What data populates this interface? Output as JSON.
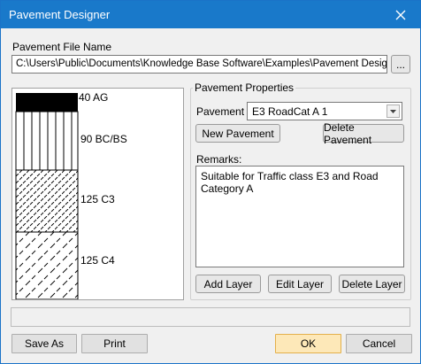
{
  "window": {
    "title": "Pavement Designer",
    "close_icon": "close-icon",
    "title_bar_color": "#1979ca"
  },
  "file": {
    "label": "Pavement File Name",
    "path": "C:\\Users\\Public\\Documents\\Knowledge Base Software\\Examples\\Pavement Designs\\TR",
    "browse_label": "..."
  },
  "layers": [
    {
      "label": "40 AG",
      "pattern": "solid-black"
    },
    {
      "label": "90 BC/BS",
      "pattern": "vertical-lines"
    },
    {
      "label": "125 C3",
      "pattern": "dashed-diagonal"
    },
    {
      "label": "125 C4",
      "pattern": "sparse-diagonal"
    }
  ],
  "properties": {
    "group_label": "Pavement Properties",
    "pavement_label": "Pavement",
    "pavement_value": "E3 RoadCat A 1",
    "new_label": "New Pavement",
    "delete_label": "Delete Pavement",
    "remarks_label": "Remarks:",
    "remarks_text": "Suitable for Traffic class E3 and Road Category A",
    "add_layer_label": "Add Layer",
    "edit_layer_label": "Edit Layer",
    "delete_layer_label": "Delete Layer"
  },
  "footer": {
    "save_as_label": "Save As",
    "print_label": "Print",
    "ok_label": "OK",
    "cancel_label": "Cancel",
    "ok_accent": "#fde8b8"
  }
}
